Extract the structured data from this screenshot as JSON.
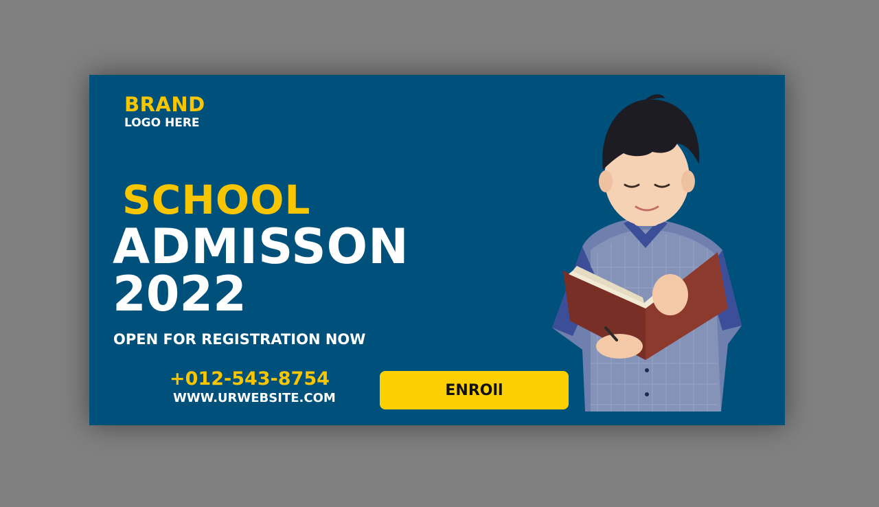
{
  "banner": {
    "brand": "BRAND",
    "logo_text": "LOGO HERE",
    "headline_1": "SCHOOL",
    "headline_2": "ADMISSON",
    "headline_3": "2022",
    "tagline": "OPEN FOR REGISTRATION NOW",
    "phone": "+012-543-8754",
    "website": "WWW.URWEBSITE.COM",
    "button_label": "ENROll"
  },
  "colors": {
    "background": "#00507c",
    "accent_yellow": "#f7c600",
    "button_yellow": "#fcd000",
    "text_white": "#ffffff",
    "outer_gray": "#808080"
  },
  "image": {
    "subject": "boy-reading-book-photo"
  }
}
